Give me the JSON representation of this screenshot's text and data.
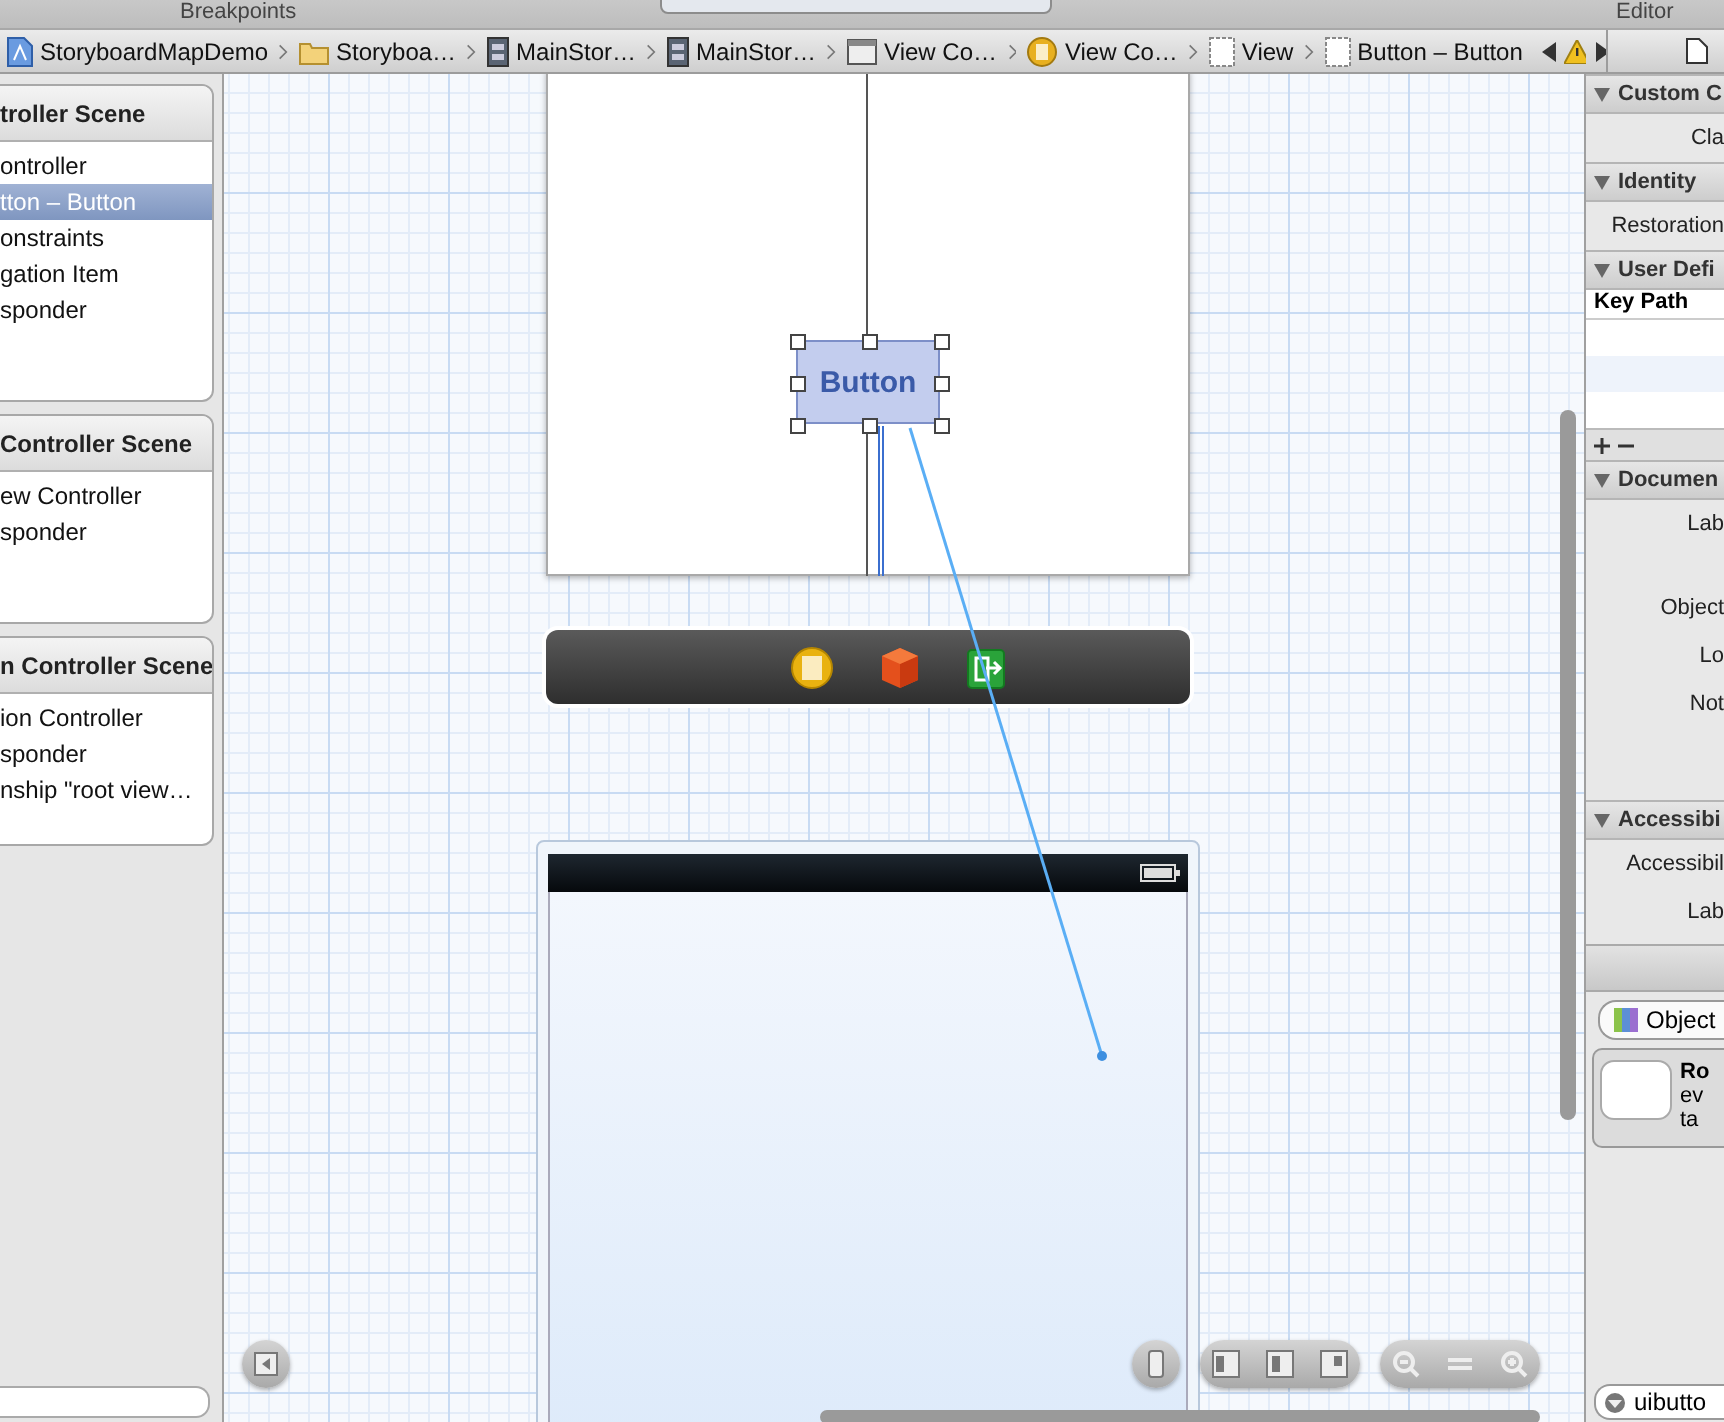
{
  "top_bar": {
    "left_label": "Breakpoints",
    "right_label": "Editor"
  },
  "jump_bar": {
    "items": [
      {
        "kind": "project",
        "label": "StoryboardMapDemo"
      },
      {
        "kind": "folder",
        "label": "Storyboa…"
      },
      {
        "kind": "storyboard",
        "label": "MainStor…"
      },
      {
        "kind": "storyboard",
        "label": "MainStor…"
      },
      {
        "kind": "scene",
        "label": "View Co…"
      },
      {
        "kind": "controller",
        "label": "View Co…"
      },
      {
        "kind": "view",
        "label": "View"
      },
      {
        "kind": "view",
        "label": "Button – Button"
      }
    ],
    "warning": true
  },
  "outline": {
    "scenes": [
      {
        "title": "troller Scene",
        "items": [
          {
            "label": "ontroller",
            "selected": false
          },
          {
            "label": "tton – Button",
            "selected": true
          },
          {
            "label": "onstraints",
            "selected": false
          },
          {
            "label": "gation Item",
            "selected": false
          },
          {
            "label": "sponder",
            "selected": false
          }
        ]
      },
      {
        "title": "Controller Scene",
        "items": [
          {
            "label": "ew Controller",
            "selected": false
          },
          {
            "label": "sponder",
            "selected": false
          }
        ]
      },
      {
        "title": "n Controller Scene",
        "items": [
          {
            "label": "ion Controller",
            "selected": false
          },
          {
            "label": "sponder",
            "selected": false
          },
          {
            "label": "nship \"root view…",
            "selected": false
          }
        ]
      }
    ]
  },
  "canvas": {
    "button": {
      "label": "Button",
      "selected": true
    }
  },
  "inspector": {
    "sections": [
      {
        "title": "Custom C",
        "expanded": true,
        "rows": [
          {
            "kind": "label",
            "label": "Cla"
          }
        ]
      },
      {
        "title": "Identity",
        "expanded": true,
        "rows": [
          {
            "kind": "label",
            "label": "Restoration"
          }
        ]
      },
      {
        "title": "User Defi",
        "expanded": true,
        "rows": [
          {
            "kind": "table",
            "label": "Key Path"
          }
        ]
      },
      {
        "title": "Documen",
        "expanded": true,
        "rows": [
          {
            "kind": "area",
            "label": "Lab"
          },
          {
            "kind": "label",
            "label": "Object"
          },
          {
            "kind": "label",
            "label": "Lo"
          },
          {
            "kind": "tall",
            "label": "Not"
          }
        ]
      },
      {
        "title": "Accessibi",
        "expanded": true,
        "rows": [
          {
            "kind": "label",
            "label": "Accessibil"
          },
          {
            "kind": "label",
            "label": "Lab"
          }
        ]
      }
    ]
  },
  "library": {
    "segment": "Object",
    "items": [
      {
        "title": "Ro",
        "lines": [
          "ev",
          "ta"
        ]
      }
    ],
    "filter": {
      "value": "uibutto"
    }
  }
}
